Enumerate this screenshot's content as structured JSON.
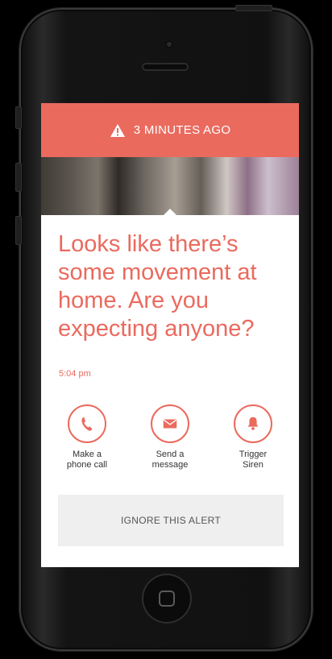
{
  "alert": {
    "time_ago": "3 MINUTES AGO",
    "icon": "warning-triangle-icon",
    "bar_color": "#ea6a5e"
  },
  "message": {
    "headline": "Looks like there’s some movement at home. Are you expecting anyone?",
    "timestamp": "5:04 pm"
  },
  "actions": [
    {
      "icon": "phone-icon",
      "label": "Make a\nphone call"
    },
    {
      "icon": "envelope-icon",
      "label": "Send a\nmessage"
    },
    {
      "icon": "bell-icon",
      "label": "Trigger\nSiren"
    }
  ],
  "ignore_button": {
    "label": "IGNORE THIS ALERT"
  },
  "colors": {
    "accent": "#ea6a5e",
    "ignore_bg": "#efefef",
    "device": "#111111"
  }
}
